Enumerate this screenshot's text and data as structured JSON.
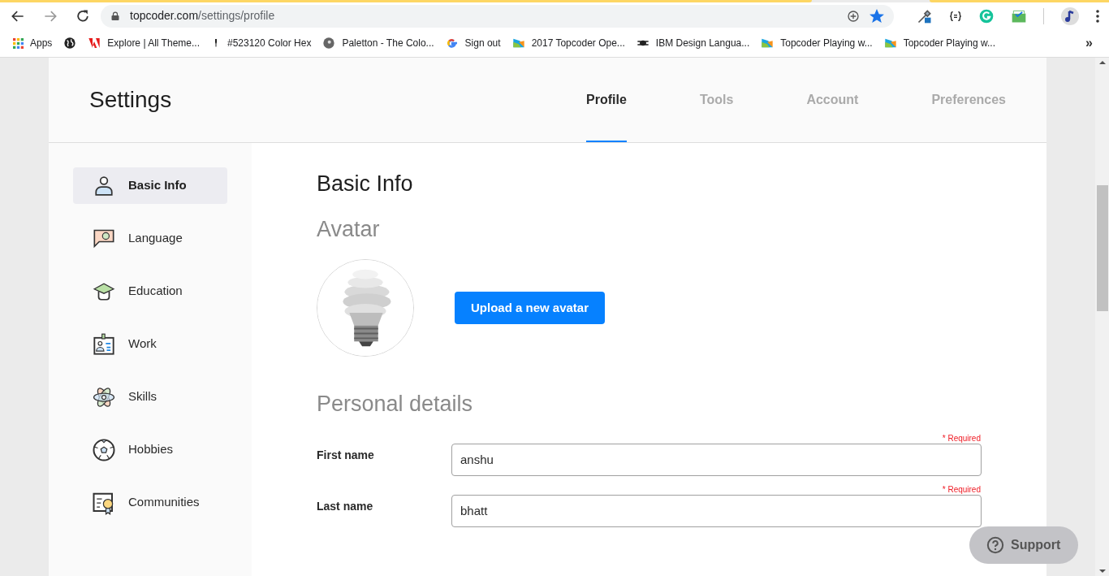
{
  "browser": {
    "url_host": "topcoder.com",
    "url_path": "/settings/profile",
    "bookmark_star_on": true,
    "bookmarks": [
      {
        "label": "Apps"
      },
      {
        "label": "Explore | All Theme..."
      },
      {
        "label": "#523120 Color Hex"
      },
      {
        "label": "Paletton - The Colo..."
      },
      {
        "label": "Sign out"
      },
      {
        "label": "2017 Topcoder Ope..."
      },
      {
        "label": "IBM Design Langua..."
      },
      {
        "label": "Topcoder Playing w..."
      },
      {
        "label": "Topcoder Playing w..."
      }
    ],
    "more": "»"
  },
  "page_title": "Settings",
  "tabs": [
    {
      "label": "Profile",
      "selected": true
    },
    {
      "label": "Tools",
      "selected": false
    },
    {
      "label": "Account",
      "selected": false
    },
    {
      "label": "Preferences",
      "selected": false
    }
  ],
  "sidebar": {
    "items": [
      {
        "label": "Basic Info",
        "selected": true
      },
      {
        "label": "Language",
        "selected": false
      },
      {
        "label": "Education",
        "selected": false
      },
      {
        "label": "Work",
        "selected": false
      },
      {
        "label": "Skills",
        "selected": false
      },
      {
        "label": "Hobbies",
        "selected": false
      },
      {
        "label": "Communities",
        "selected": false
      }
    ]
  },
  "content": {
    "heading": "Basic Info",
    "avatar_title": "Avatar",
    "upload_button": "Upload a new avatar",
    "details_title": "Personal details",
    "fields": [
      {
        "label": "First name",
        "value": "anshu",
        "note": "* Required"
      },
      {
        "label": "Last name",
        "value": "bhatt",
        "note": "* Required"
      }
    ]
  },
  "support": "Support"
}
